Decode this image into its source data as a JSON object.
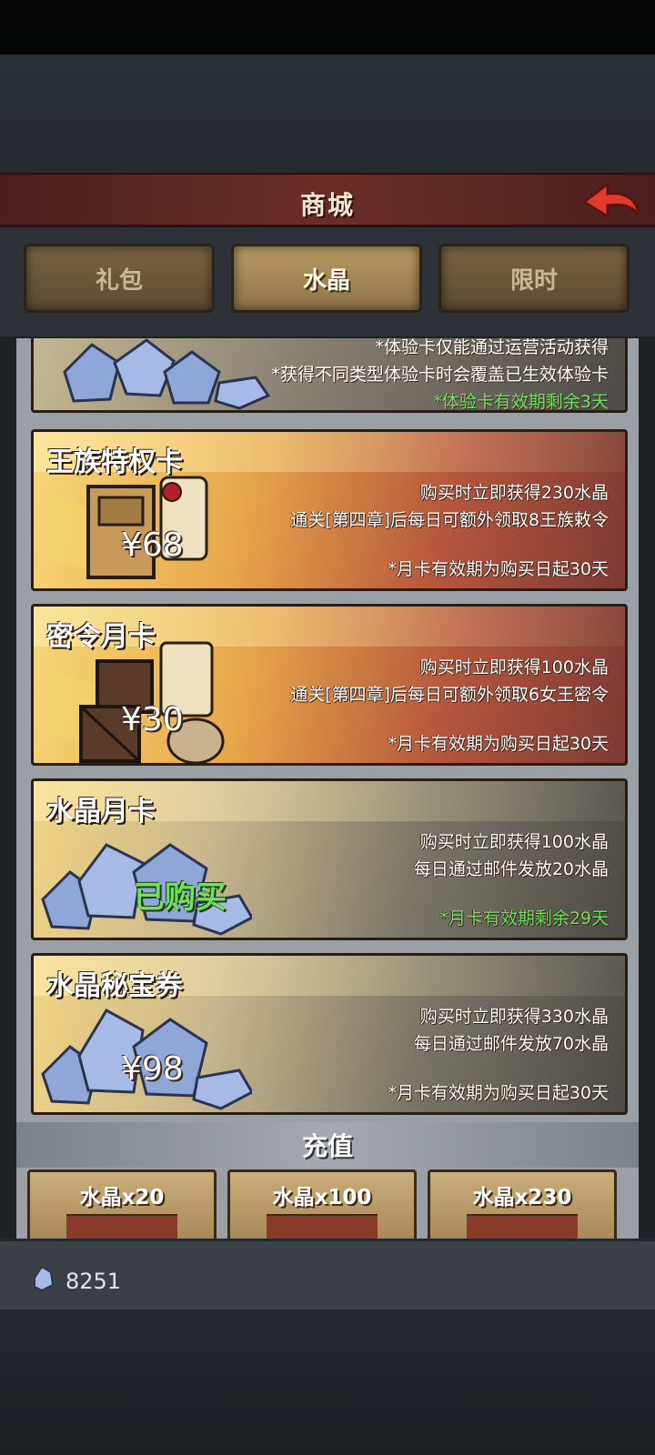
{
  "header": {
    "title": "商城"
  },
  "tabs": [
    {
      "label": "礼包",
      "active": false
    },
    {
      "label": "水晶",
      "active": true
    },
    {
      "label": "限时",
      "active": false
    }
  ],
  "trial_card": {
    "lines": [
      "*体验卡仅能通过运营活动获得",
      "*获得不同类型体验卡时会覆盖已生效体验卡",
      "*体验卡有效期剩余3天"
    ]
  },
  "cards": [
    {
      "name": "王族特权卡",
      "line1": "购买时立即获得230水晶",
      "line2": "通关[第四章]后每日可额外领取8王族敕令",
      "price": "¥68",
      "note": "*月卡有效期为购买日起30天"
    },
    {
      "name": "密令月卡",
      "line1": "购买时立即获得100水晶",
      "line2": "通关[第四章]后每日可额外领取6女王密令",
      "price": "¥30",
      "note": "*月卡有效期为购买日起30天"
    },
    {
      "name": "水晶月卡",
      "line1": "购买时立即获得100水晶",
      "line2": "每日通过邮件发放20水晶",
      "status": "已购买",
      "note": "*月卡有效期剩余29天"
    },
    {
      "name": "水晶秘宝券",
      "line1": "购买时立即获得330水晶",
      "line2": "每日通过邮件发放70水晶",
      "price": "¥98",
      "note": "*月卡有效期为购买日起30天"
    }
  ],
  "recharge": {
    "title": "充值",
    "packs": [
      "水晶x20",
      "水晶x100",
      "水晶x230"
    ]
  },
  "footer": {
    "crystal_count": "8251"
  },
  "colors": {
    "accent_green": "#6fe063",
    "header_red": "#6b2c27",
    "back_arrow": "#e23b2e"
  }
}
